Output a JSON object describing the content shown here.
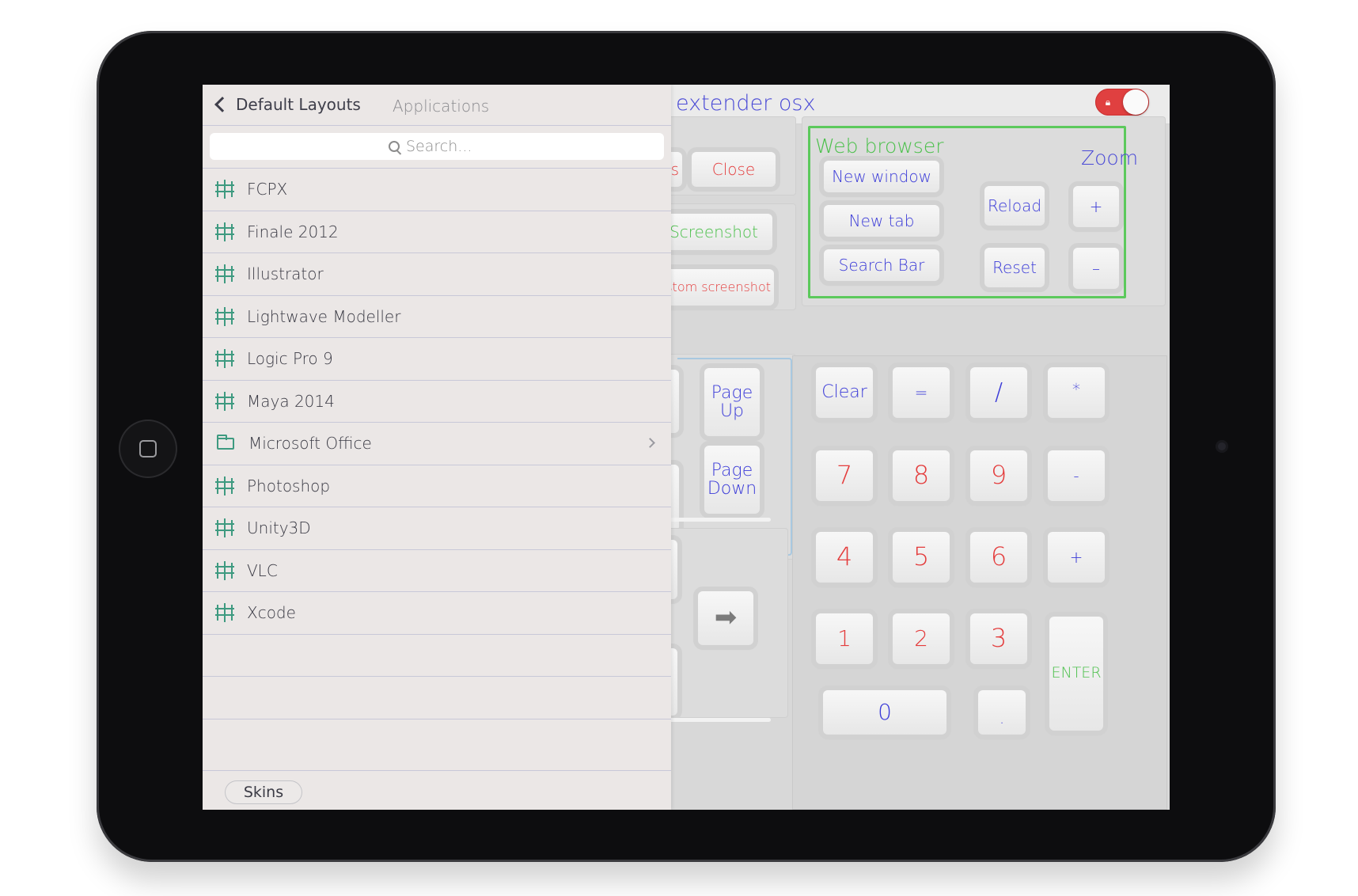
{
  "app": {
    "title": "extender osx",
    "lock_icon": "lock-icon"
  },
  "sidebar": {
    "back_label": "Default Layouts",
    "header_title": "Applications",
    "search_placeholder": "Search...",
    "items": [
      {
        "label": "FCPX",
        "icon": "grid-icon"
      },
      {
        "label": "Finale 2012",
        "icon": "grid-icon"
      },
      {
        "label": "Illustrator",
        "icon": "grid-icon"
      },
      {
        "label": "Lightwave Modeller",
        "icon": "grid-icon"
      },
      {
        "label": "Logic Pro 9",
        "icon": "grid-icon"
      },
      {
        "label": "Maya 2014",
        "icon": "grid-icon"
      },
      {
        "label": "Microsoft Office",
        "icon": "folder-icon"
      },
      {
        "label": "Photoshop",
        "icon": "grid-icon"
      },
      {
        "label": "Unity3D",
        "icon": "grid-icon"
      },
      {
        "label": "VLC",
        "icon": "grid-icon"
      },
      {
        "label": "Xcode",
        "icon": "grid-icon"
      }
    ],
    "skins_label": "Skins"
  },
  "keys": {
    "close": "Close",
    "partial_s": "s",
    "screenshot": "Screenshot",
    "custom_screenshot": "ustom screenshot",
    "page_up_1": "Page",
    "page_up_2": "Up",
    "page_down_1": "Page",
    "page_down_2": "Down"
  },
  "web": {
    "title": "Web browser",
    "zoom_title": "Zoom",
    "new_window": "New window",
    "new_tab": "New tab",
    "search_bar": "Search Bar",
    "reload": "Reload",
    "reset": "Reset",
    "zoom_in": "+",
    "zoom_out": "–"
  },
  "numpad": {
    "clear": "Clear",
    "equals": "=",
    "divide": "/",
    "multiply": "*",
    "n7": "7",
    "n8": "8",
    "n9": "9",
    "minus": "-",
    "n4": "4",
    "n5": "5",
    "n6": "6",
    "plus": "+",
    "n1": "1",
    "n2": "2",
    "n3": "3",
    "n0": "0",
    "dot": ".",
    "enter": "ENTER"
  },
  "colors": {
    "accent_blue": "#3b3bd8",
    "accent_red": "#e43c3c",
    "accent_green": "#4cc04c",
    "sidebar_icon": "#3e9a80"
  }
}
